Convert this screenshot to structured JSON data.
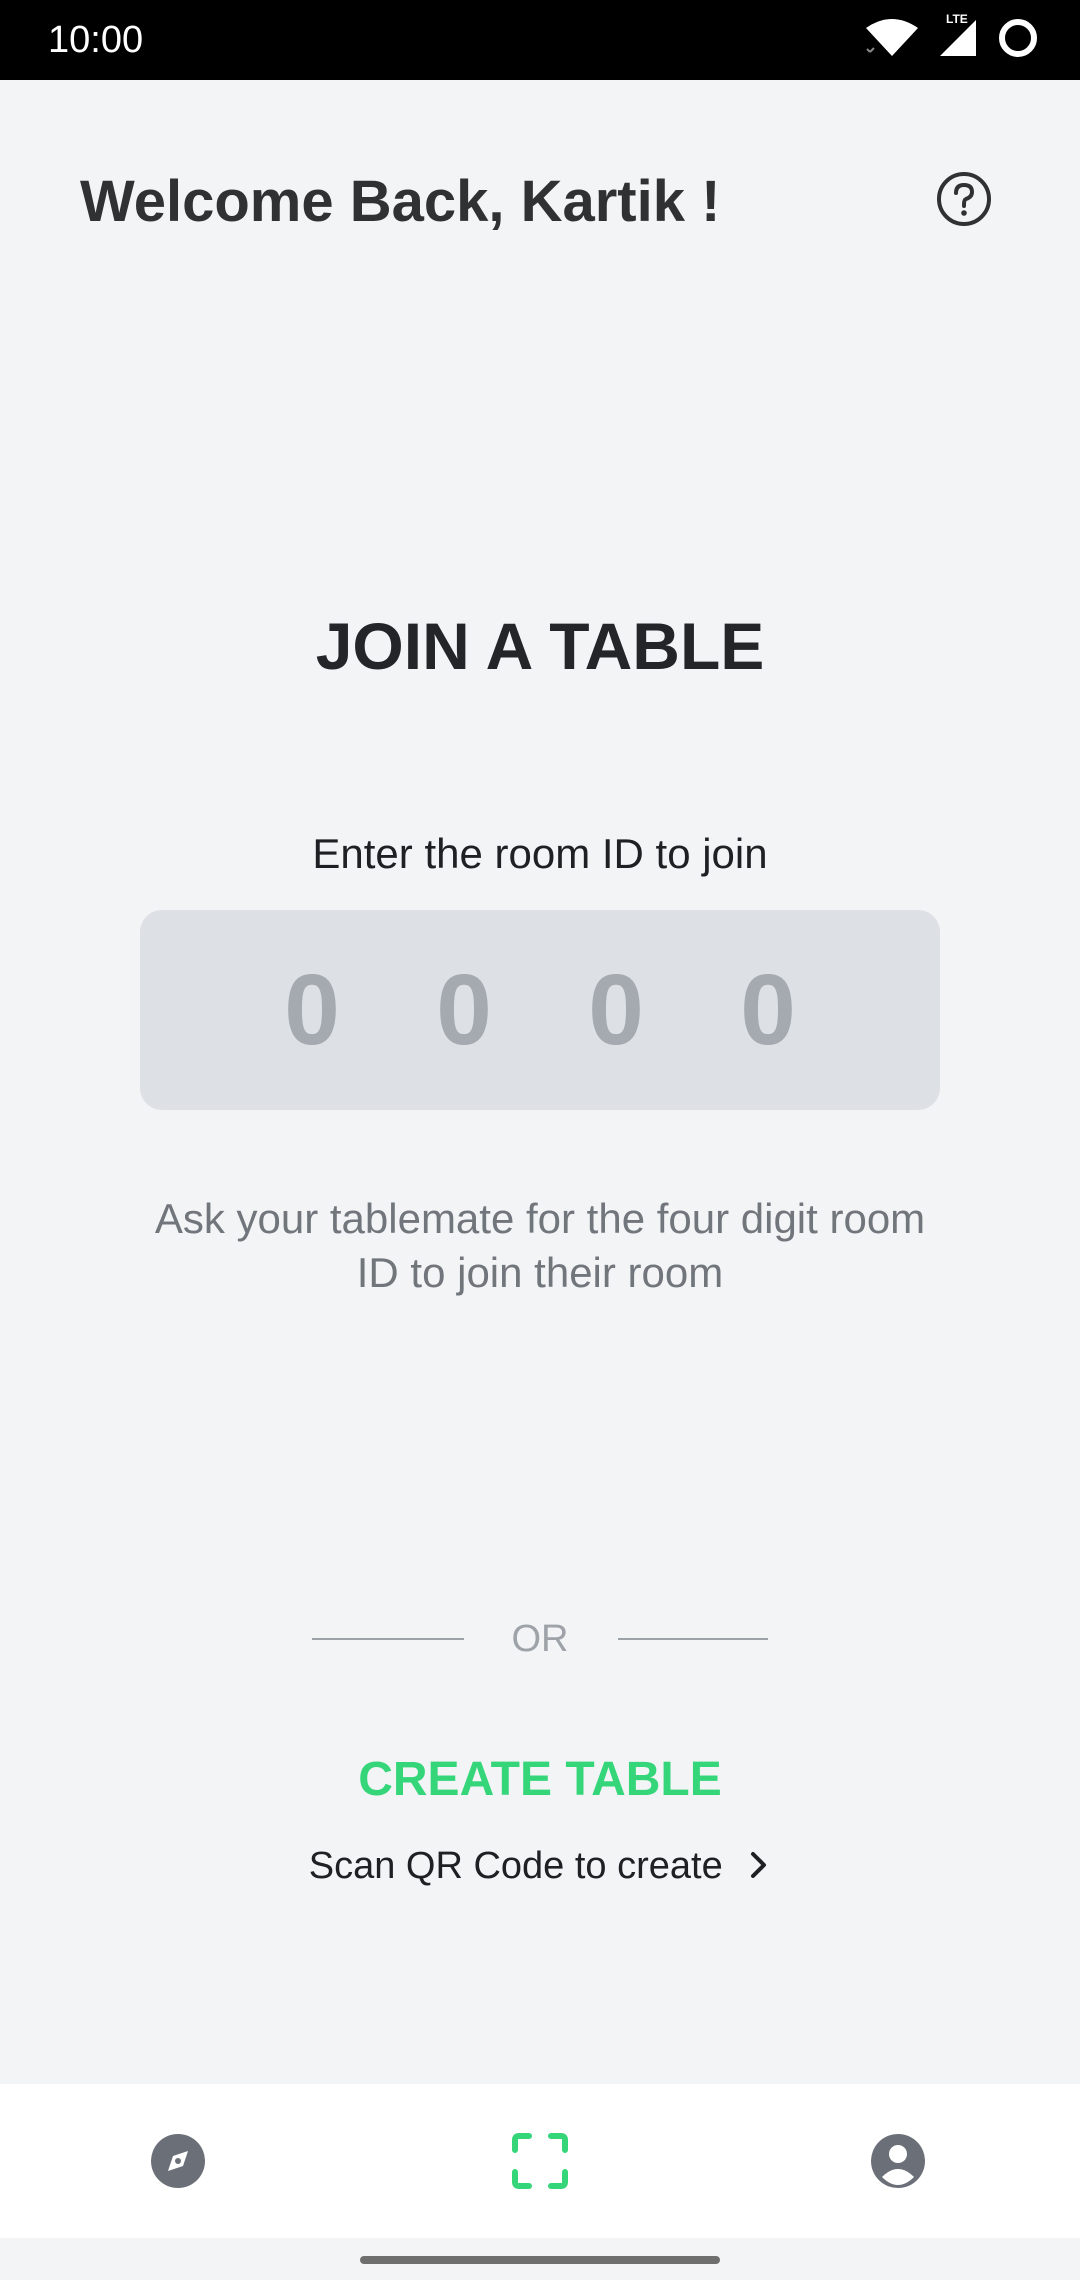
{
  "status_bar": {
    "time": "10:00",
    "network_label": "LTE"
  },
  "header": {
    "title": "Welcome Back, Kartik !",
    "help_icon": "help-circle-icon"
  },
  "join": {
    "heading": "JOIN A TABLE",
    "prompt": "Enter the room ID to join",
    "digits": [
      "0",
      "0",
      "0",
      "0"
    ],
    "hint": "Ask your tablemate for the four digit room ID to join their room"
  },
  "divider": {
    "label": "OR"
  },
  "create": {
    "button_label": "CREATE TABLE",
    "scan_label": "Scan QR Code to create"
  },
  "bottom_nav": {
    "items": [
      {
        "icon": "compass-icon",
        "active": false
      },
      {
        "icon": "scan-icon",
        "active": true
      },
      {
        "icon": "account-icon",
        "active": false
      }
    ]
  },
  "colors": {
    "accent": "#35d67a",
    "background": "#f3f4f6",
    "code_box": "#dde0e4",
    "nav_icon": "#6b7078"
  }
}
